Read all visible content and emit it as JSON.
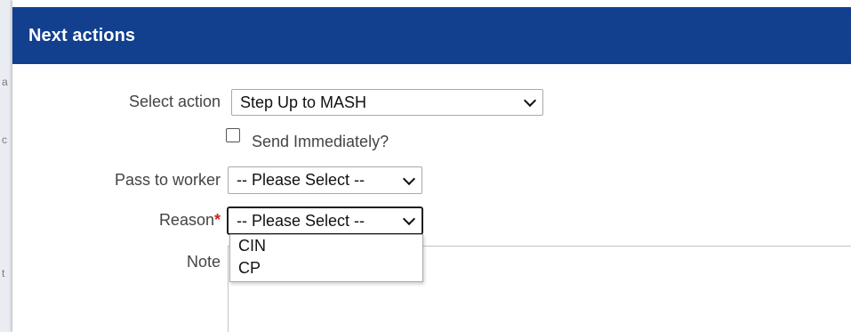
{
  "modal": {
    "title": "Next actions"
  },
  "form": {
    "select_action": {
      "label": "Select action",
      "value": "Step Up to MASH"
    },
    "send_immediately": {
      "label": "Send Immediately?",
      "checked": false
    },
    "pass_to_worker": {
      "label": "Pass to worker",
      "value": "-- Please Select --"
    },
    "reason": {
      "label": "Reason",
      "required_marker": "*",
      "value": "-- Please Select --",
      "options": [
        "CIN",
        "CP"
      ]
    },
    "note": {
      "label": "Note",
      "value": ""
    }
  },
  "colors": {
    "header_bg": "#12408f",
    "header_text": "#ffffff",
    "required": "#cc2222"
  },
  "icons": {
    "select_indicator": "chevron-down-icon",
    "checkbox": "checkbox-icon"
  }
}
